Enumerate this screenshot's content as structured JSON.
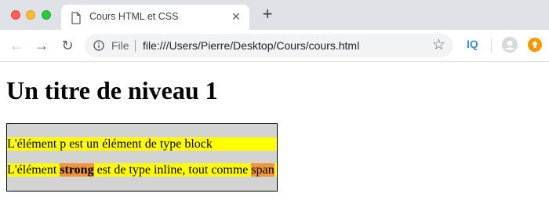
{
  "browser": {
    "tab": {
      "title": "Cours HTML et CSS",
      "close_glyph": "✕",
      "icon": "document-icon"
    },
    "new_tab_glyph": "+",
    "nav": {
      "back_glyph": "←",
      "forward_glyph": "→",
      "reload_glyph": "↻"
    },
    "address_bar": {
      "scheme_label": "File",
      "url": "file:///Users/Pierre/Desktop/Cours/cours.html",
      "star_glyph": "☆",
      "info_icon": "info-icon"
    },
    "extensions": {
      "iq_label": "IQ",
      "profile_icon": "profile-avatar-icon",
      "update_icon": "update-arrow-icon"
    },
    "colors": {
      "tabstrip": "#dee1e6",
      "omnibox": "#f1f3f4",
      "update": "#f29900",
      "iq": "#3d8fdb"
    }
  },
  "page": {
    "heading": "Un titre de niveau 1",
    "paragraph_1": "L'élément p est un élément de type block",
    "paragraph_2": {
      "before": "L'élément ",
      "strong": "strong",
      "middle": " est de type inline, tout comme ",
      "span": "span"
    },
    "colors": {
      "box_background": "#d3d3d3",
      "paragraph_background": "#ffff00",
      "inline_highlight": "#f2943a"
    }
  }
}
